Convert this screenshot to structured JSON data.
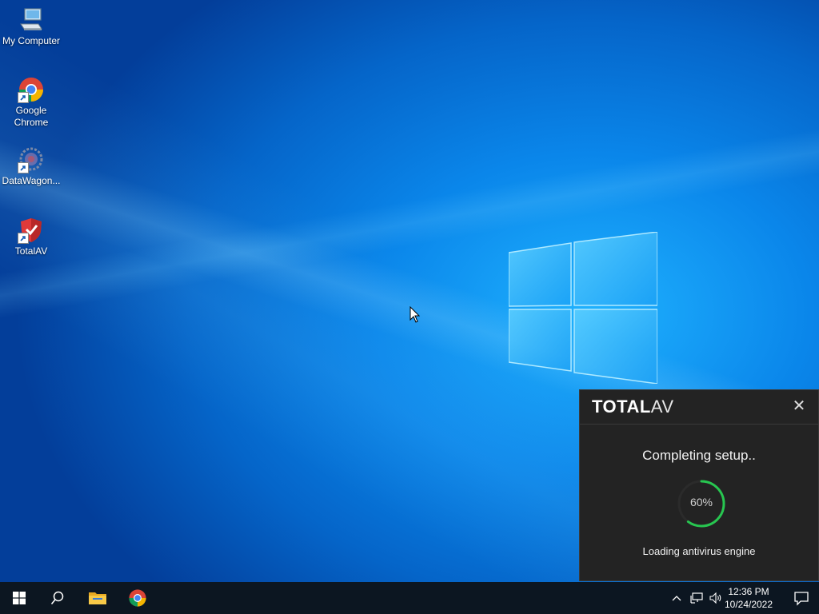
{
  "desktop": {
    "icons": [
      {
        "label": "My Computer",
        "icon": "computer-icon"
      },
      {
        "label": "Google Chrome",
        "icon": "chrome-icon"
      },
      {
        "label": "DataWagon...",
        "icon": "datawagon-icon"
      },
      {
        "label": "TotalAV",
        "icon": "totalav-shield-icon"
      }
    ]
  },
  "installer": {
    "brand_bold": "TOTAL",
    "brand_light": "AV",
    "close_label": "✕",
    "status": "Completing setup..",
    "progress": 0.6,
    "progress_label": "60%",
    "subtext": "Loading antivirus engine",
    "accent_color": "#27c650"
  },
  "taskbar": {
    "start_icon": "windows-start-icon",
    "search_icon": "search-icon",
    "pinned": [
      {
        "name": "file-explorer-icon"
      },
      {
        "name": "chrome-icon"
      }
    ],
    "tray_icons": [
      "chevron-up-icon",
      "network-icon",
      "volume-icon"
    ],
    "time": "12:36 PM",
    "date": "10/24/2022",
    "notification_icon": "notification-icon"
  }
}
